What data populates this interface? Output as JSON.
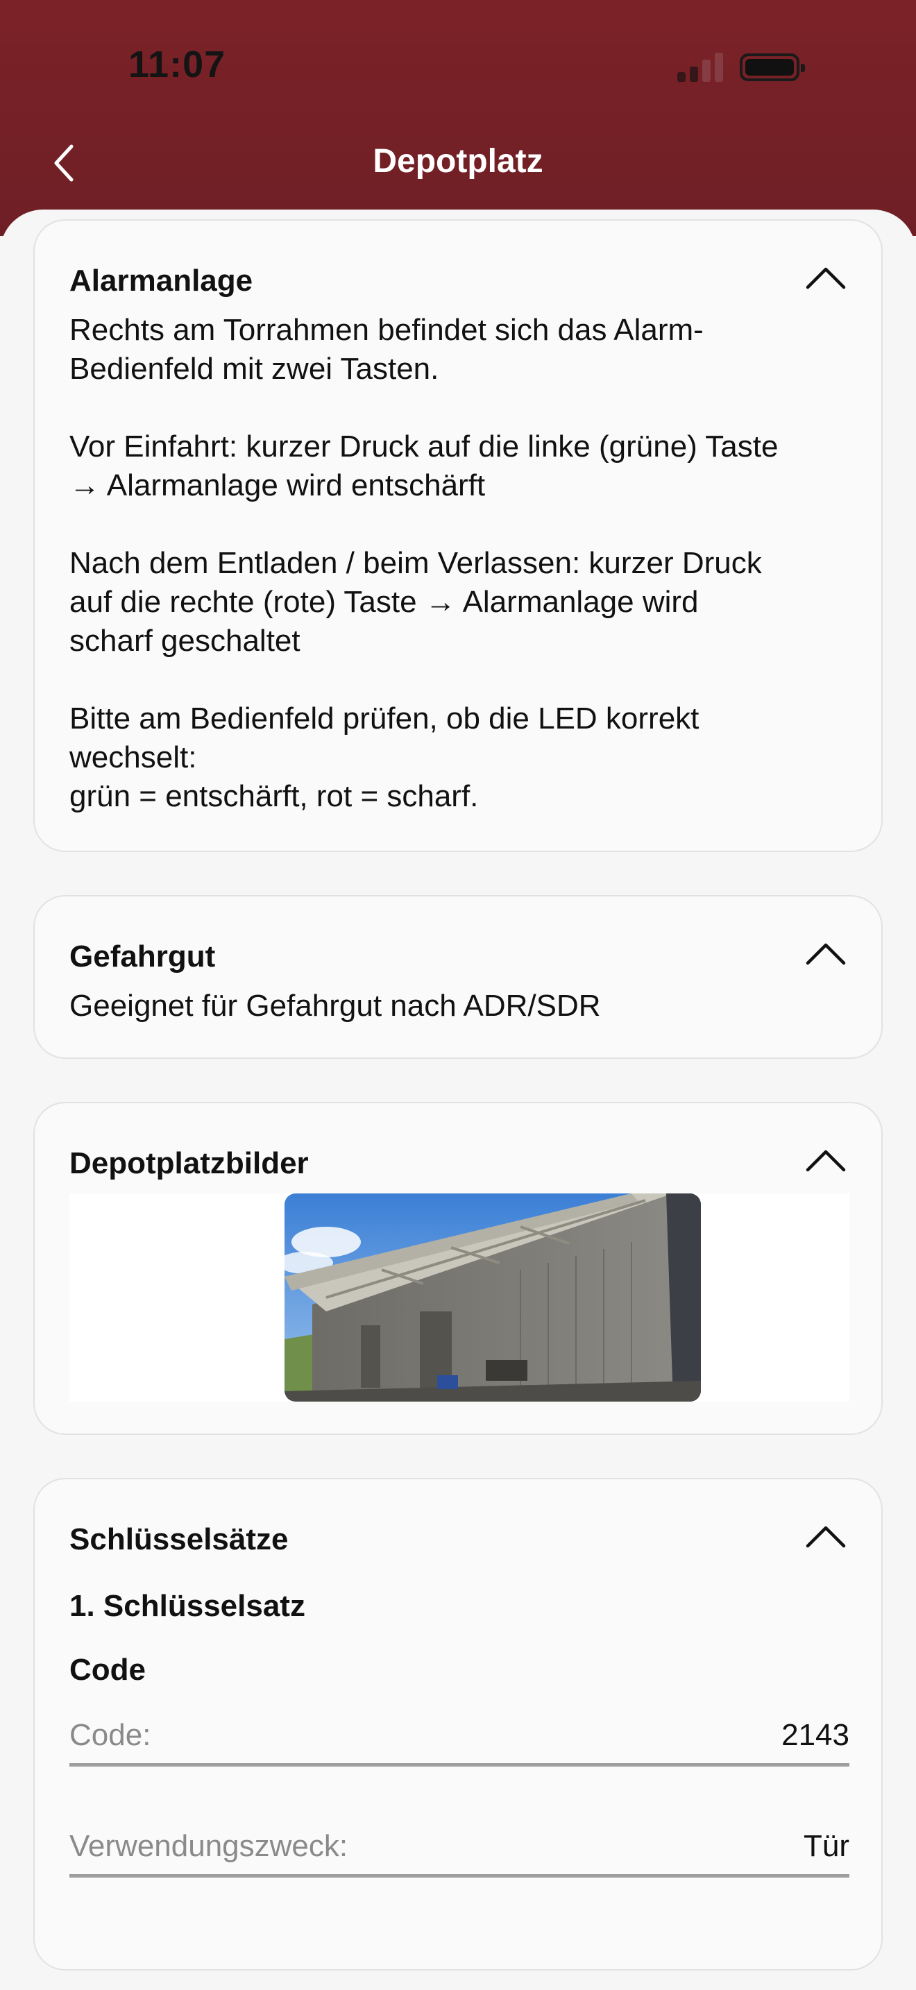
{
  "status_bar": {
    "time": "11:07"
  },
  "header": {
    "title": "Depotplatz"
  },
  "cards": {
    "alarm": {
      "title": "Alarmanlage",
      "paragraphs": [
        [
          "Rechts am Torrahmen befindet sich das Alarm-",
          "Bedienfeld mit zwei Tasten."
        ],
        [
          "Vor Einfahrt: kurzer Druck auf die linke (grüne) Taste",
          "→ Alarmanlage wird entschärft"
        ],
        [
          "Nach dem Entladen / beim Verlassen: kurzer Druck",
          "auf die rechte (rote) Taste → Alarmanlage wird",
          "scharf geschaltet"
        ],
        [
          "Bitte am Bedienfeld prüfen, ob die LED korrekt",
          "wechselt:",
          "grün = entschärft, rot = scharf."
        ]
      ]
    },
    "hazmat": {
      "title": "Gefahrgut",
      "text": "Geeignet für Gefahrgut nach ADR/SDR"
    },
    "images": {
      "title": "Depotplatzbilder"
    },
    "keys": {
      "title": "Schlüsselsätze",
      "set_title": "1. Schlüsselsatz",
      "section_title": "Code",
      "code_label": "Code:",
      "code_value": "2143",
      "purpose_label": "Verwendungszweck:",
      "purpose_value": "Tür"
    }
  },
  "colors": {
    "header_bg": "#7b2228",
    "card_bg": "#fafafa",
    "card_border": "#e2e2e2",
    "label_gray": "#8a8a8a"
  },
  "icons": {
    "back": "chevron-left-icon",
    "collapse": "chevron-up-icon",
    "battery": "battery-icon",
    "signal": "signal-icon"
  }
}
